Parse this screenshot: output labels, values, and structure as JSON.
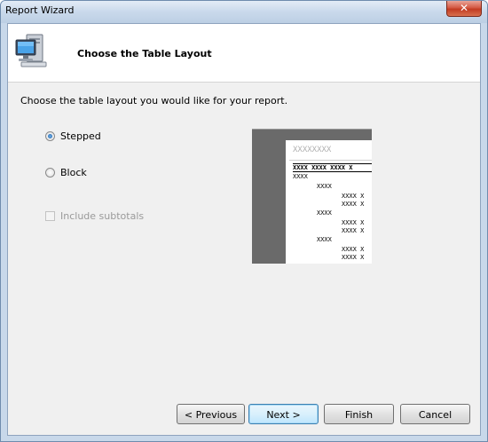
{
  "window": {
    "title": "Report Wizard",
    "close_glyph": "✕"
  },
  "header": {
    "title": "Choose the Table Layout",
    "icon": "computer-icon"
  },
  "instruction": "Choose the table layout you would like for your report.",
  "layout_options": [
    {
      "label": "Stepped",
      "checked": true
    },
    {
      "label": "Block",
      "checked": false
    }
  ],
  "include_subtotals": {
    "label": "Include subtotals",
    "checked": false,
    "enabled": false
  },
  "preview": {
    "title": "XXXXXXXX",
    "header": "XXXX  XXXX  XXXX  X",
    "rows": [
      "XXXX",
      "XXXX",
      "XXXX  X",
      "XXXX  X",
      "XXXX",
      "XXXX  X",
      "XXXX  X",
      "XXXX",
      "XXXX  X",
      "XXXX  X"
    ]
  },
  "buttons": {
    "previous": "< Previous",
    "next": "Next >",
    "finish": "Finish",
    "cancel": "Cancel"
  }
}
